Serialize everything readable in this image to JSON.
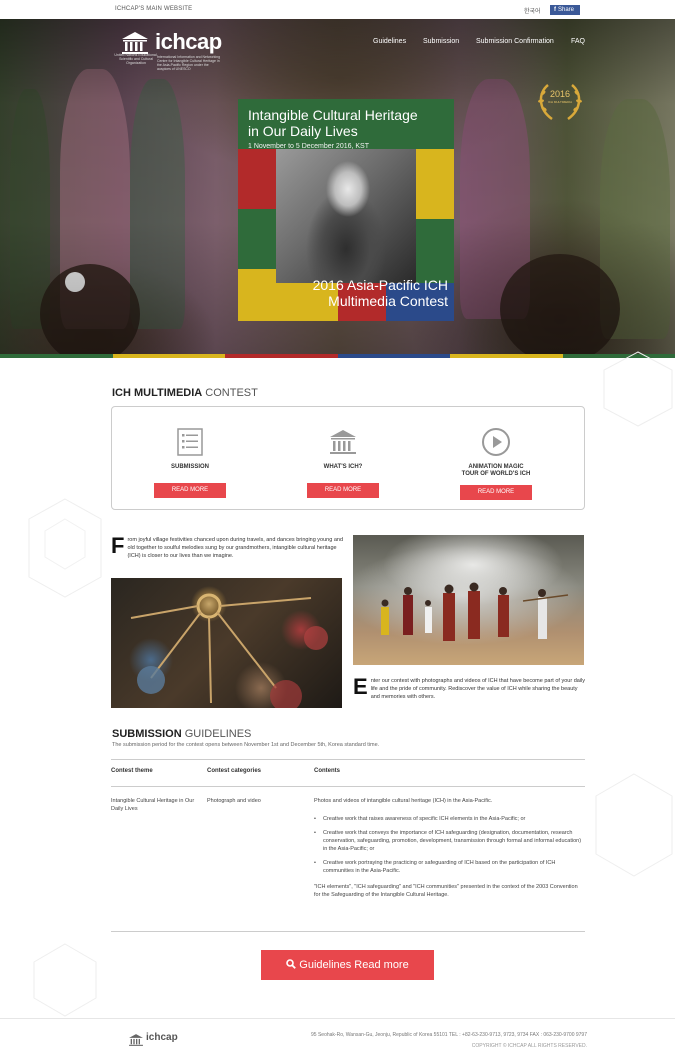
{
  "topbar": {
    "main_site": "ICHCAP'S MAIN WEBSITE",
    "lang": "한국어",
    "share": "Share"
  },
  "header": {
    "brand": "ichcap",
    "unesco_text": "United Nations Educational, Scientific and Cultural Organization",
    "brand_sub": "International Information and Networking Centre for Intangible Cultural Heritage in the Asia-Pacific Region under the auspices of UNESCO",
    "nav": [
      "Guidelines",
      "Submission",
      "Submission Confirmation",
      "FAQ"
    ]
  },
  "hero": {
    "title_line1": "Intangible Cultural Heritage",
    "title_line2": "in Our Daily Lives",
    "dates": "1 November to 5 December 2016, KST",
    "contest_line1": "2016 Asia-Pacific ICH",
    "contest_line2": "Multimedia Contest",
    "laurel_year": "2016",
    "laurel_text": "ICH MULTIMEDIA"
  },
  "contest_section": {
    "title_bold": "ICH MULTIMEDIA",
    "title_light": " CONTEST",
    "cards": [
      {
        "icon": "document-list-icon",
        "label": "SUBMISSION",
        "button": "READ MORE"
      },
      {
        "icon": "temple-icon",
        "label": "WHAT'S ICH?",
        "button": "READ MORE"
      },
      {
        "icon": "play-icon",
        "label_line1": "ANIMATION MAGIC",
        "label_line2": "TOUR OF WORLD'S ICH",
        "button": "READ MORE"
      }
    ]
  },
  "intro": {
    "para1_cap": "F",
    "para1": "rom joyful village festivities chanced upon during travels, and dances bringing young and old together to soulful melodies sung by our grandmothers, intangible cultural heritage (ICH) is closer to our lives than we imagine.",
    "para2_cap": "E",
    "para2": "nter our contest with photographs and videos of ICH that have become part of your daily life and the pride of community. Rediscover the value of ICH while sharing the beauty and memories with others."
  },
  "guidelines": {
    "title_bold": "SUBMISSION",
    "title_light": " GUIDELINES",
    "note": "The submission period for the contest opens between November 1st and December 5th, Korea standard time.",
    "headers": [
      "Contest theme",
      "Contest categories",
      "Contents"
    ],
    "theme": "Intangible Cultural Heritage in Our Daily Lives",
    "categories": "Photograph and video",
    "contents_intro": "Photos and videos of intangible cultural heritage (ICH) in the Asia-Pacific.",
    "bullets": [
      "Creative work that raises awareness of specific ICH elements in the Asia-Pacific; or",
      "Creative work that conveys the importance of ICH safeguarding (designation, documentation, research conservation, safeguarding, promotion, development, transmission through formal and informal education) in the Asia-Pacific; or",
      "Creative work portraying the practicing or safeguarding of ICH based on the participation of ICH communities in the Asia-Pacific."
    ],
    "note2": "\"ICH elements\", \"ICH safeguarding\" and \"ICH communities\" presented in the context of the 2003 Convention for the Safeguarding of the Intangible Cultural Heritage.",
    "button": "Guidelines Read more"
  },
  "footer": {
    "brand": "ichcap",
    "address": "95 Seohak-Ro, Wansan-Gu, Jeonju, Republic of Korea 55101 TEL : +82-63-230-9713, 9723, 9734 FAX : 063-230-9700 9797",
    "copyright": "COPYRIGHT © ICHCAP ALL RIGHTS RESERVED."
  },
  "colors": {
    "accent": "#e8474c",
    "green": "#2f6b3a",
    "yellow": "#d8b51e",
    "red": "#b22a2a",
    "blue": "#2b4a8a"
  }
}
